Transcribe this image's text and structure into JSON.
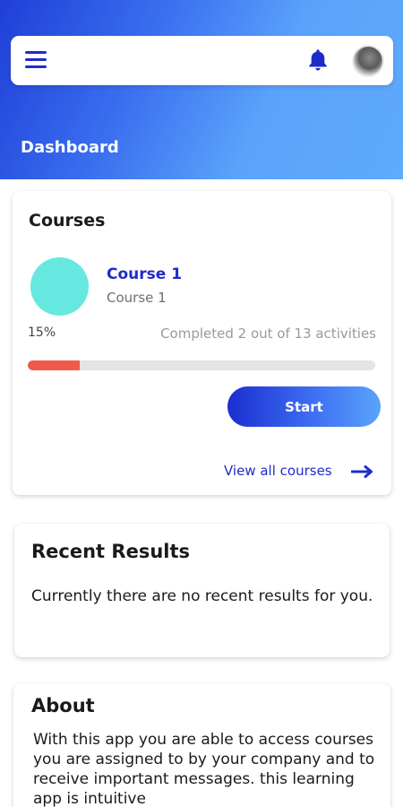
{
  "header": {
    "page_title": "Dashboard",
    "menu_icon": "hamburger-menu-icon",
    "notification_icon": "bell-icon",
    "avatar_icon": "user-avatar",
    "accent_color": "#1f2bc9"
  },
  "courses_card": {
    "heading": "Courses",
    "course": {
      "title": "Course 1",
      "subtitle": "Course 1",
      "progress_label": "15%",
      "progress_fraction": 0.15,
      "completed_text": "Completed 2 out of 13 activities"
    },
    "start_label": "Start",
    "view_all_label": "View all courses",
    "view_all_icon": "arrow-right-icon"
  },
  "results_card": {
    "heading": "Recent Results",
    "text": "Currently there are no recent results for you."
  },
  "about_card": {
    "heading": "About",
    "text": "With this app you are able to access courses you are assigned to by your company and to receive important messages. this learning app is intuitive"
  }
}
